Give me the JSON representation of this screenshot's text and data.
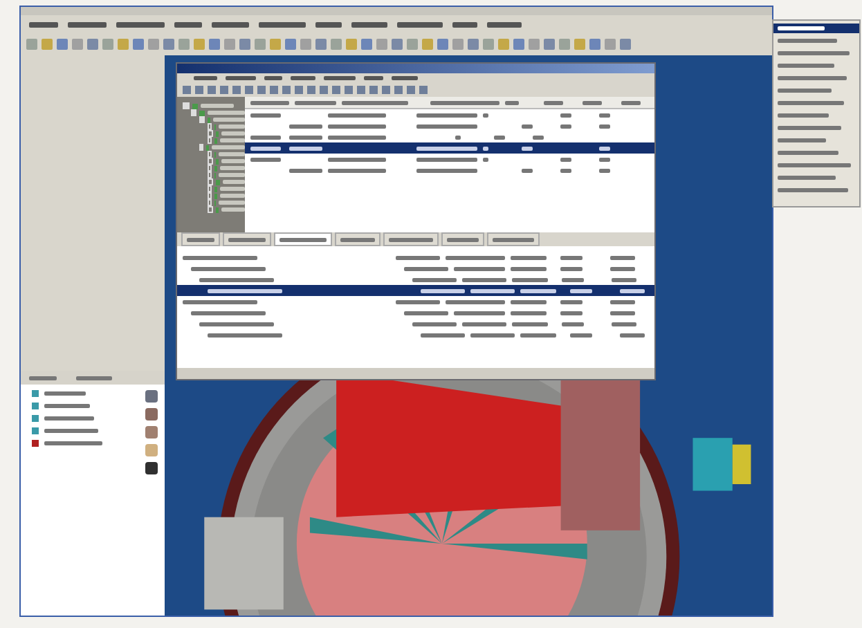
{
  "palette_list": {
    "items": [
      {
        "selected": true
      },
      {
        "selected": false
      },
      {
        "selected": false
      },
      {
        "selected": false
      },
      {
        "selected": false
      },
      {
        "selected": false
      },
      {
        "selected": false
      },
      {
        "selected": false
      },
      {
        "selected": false
      },
      {
        "selected": false
      },
      {
        "selected": false
      },
      {
        "selected": false
      },
      {
        "selected": false
      },
      {
        "selected": false
      }
    ]
  },
  "subwindow": {
    "tree": [
      {
        "expanded": true,
        "children": [
          {
            "expanded": true,
            "children": [
              {
                "expanded": true,
                "children": [
                  {
                    "expanded": false
                  },
                  {
                    "expanded": false
                  },
                  {
                    "expanded": false
                  }
                ]
              },
              {
                "expanded": true,
                "children": [
                  {
                    "expanded": false
                  },
                  {
                    "expanded": false
                  },
                  {
                    "expanded": false
                  },
                  {
                    "expanded": false
                  },
                  {
                    "expanded": false
                  },
                  {
                    "expanded": false
                  },
                  {
                    "expanded": false
                  },
                  {
                    "expanded": false
                  },
                  {
                    "expanded": false
                  }
                ]
              }
            ]
          }
        ]
      }
    ],
    "upper_table": {
      "rows": [
        {
          "selected": false
        },
        {
          "selected": false
        },
        {
          "selected": false
        },
        {
          "selected": true
        },
        {
          "selected": false
        },
        {
          "selected": false
        }
      ]
    },
    "tabs": [
      {
        "selected": false
      },
      {
        "selected": false
      },
      {
        "selected": true
      },
      {
        "selected": false
      },
      {
        "selected": false
      },
      {
        "selected": false
      },
      {
        "selected": false
      }
    ],
    "lower_table": {
      "rows": [
        {
          "selected": false
        },
        {
          "selected": false
        },
        {
          "selected": false
        },
        {
          "selected": true
        },
        {
          "selected": false
        },
        {
          "selected": false
        },
        {
          "selected": false
        },
        {
          "selected": false
        }
      ]
    }
  },
  "structure_list": {
    "items": [
      {
        "color": "#3a9aa8"
      },
      {
        "color": "#3a9aa8"
      },
      {
        "color": "#3a9aa8"
      },
      {
        "color": "#3a9aa8"
      },
      {
        "color": "#b02020"
      }
    ]
  }
}
